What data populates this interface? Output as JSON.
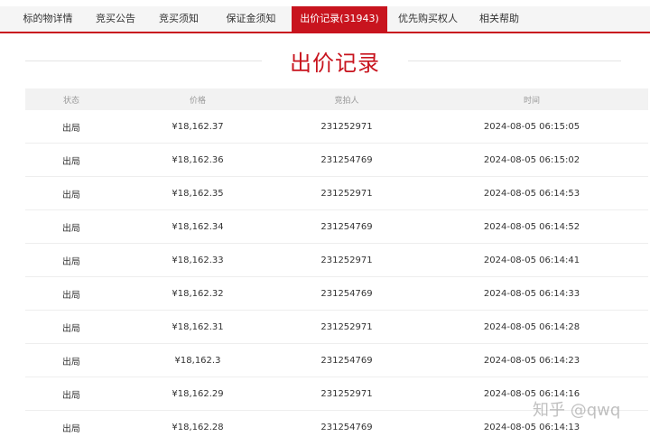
{
  "tabs": [
    {
      "label": "标的物详情",
      "active": false
    },
    {
      "label": "竞买公告",
      "active": false
    },
    {
      "label": "竞买须知",
      "active": false
    },
    {
      "label": "保证金须知",
      "active": false
    },
    {
      "label": "出价记录(31943)",
      "active": true
    },
    {
      "label": "优先购买权人",
      "active": false
    },
    {
      "label": "相关帮助",
      "active": false
    }
  ],
  "section": {
    "title": "出价记录"
  },
  "table": {
    "headers": {
      "status": "状态",
      "price": "价格",
      "bidder": "竞拍人",
      "time": "时间"
    },
    "rows": [
      {
        "status": "出局",
        "price": "¥18,162.37",
        "bidder": "231252971",
        "time": "2024-08-05 06:15:05"
      },
      {
        "status": "出局",
        "price": "¥18,162.36",
        "bidder": "231254769",
        "time": "2024-08-05 06:15:02"
      },
      {
        "status": "出局",
        "price": "¥18,162.35",
        "bidder": "231252971",
        "time": "2024-08-05 06:14:53"
      },
      {
        "status": "出局",
        "price": "¥18,162.34",
        "bidder": "231254769",
        "time": "2024-08-05 06:14:52"
      },
      {
        "status": "出局",
        "price": "¥18,162.33",
        "bidder": "231252971",
        "time": "2024-08-05 06:14:41"
      },
      {
        "status": "出局",
        "price": "¥18,162.32",
        "bidder": "231254769",
        "time": "2024-08-05 06:14:33"
      },
      {
        "status": "出局",
        "price": "¥18,162.31",
        "bidder": "231252971",
        "time": "2024-08-05 06:14:28"
      },
      {
        "status": "出局",
        "price": "¥18,162.3",
        "bidder": "231254769",
        "time": "2024-08-05 06:14:23"
      },
      {
        "status": "出局",
        "price": "¥18,162.29",
        "bidder": "231252971",
        "time": "2024-08-05 06:14:16"
      },
      {
        "status": "出局",
        "price": "¥18,162.28",
        "bidder": "231254769",
        "time": "2024-08-05 06:14:13"
      }
    ]
  },
  "watermark": "知乎 @qwq",
  "colors": {
    "accent": "#c8141e",
    "header_bg": "#f2f2f2",
    "tab_bg": "#f5f5f5"
  }
}
